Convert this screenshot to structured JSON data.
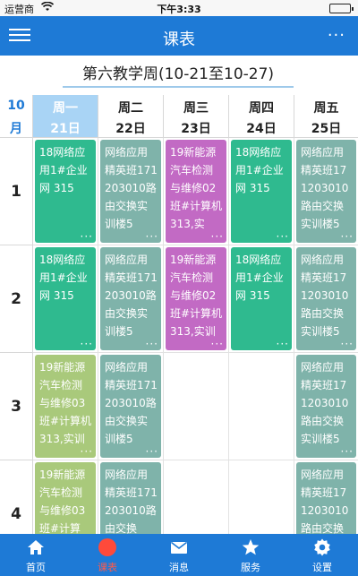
{
  "status_bar": {
    "carrier": "运营商",
    "time": "下午3:33"
  },
  "nav": {
    "title": "课表",
    "more": "···"
  },
  "week": {
    "label": "第六教学周(10-21至10-27)"
  },
  "month": {
    "number": "10",
    "unit": "月"
  },
  "days": [
    {
      "name": "周一",
      "date": "21日",
      "is_today": true
    },
    {
      "name": "周二",
      "date": "22日",
      "is_today": false
    },
    {
      "name": "周三",
      "date": "23日",
      "is_today": false
    },
    {
      "name": "周四",
      "date": "24日",
      "is_today": false
    },
    {
      "name": "周五",
      "date": "25日",
      "is_today": false
    }
  ],
  "periods": [
    "1",
    "2",
    "3",
    "4"
  ],
  "courses": {
    "mon_1": "18网络应用1#企业网 315",
    "tue_1": "网络应用精英班171203010路由交换实训楼5",
    "wed_1": "19新能源汽车检测与维修02班#计算机 313,实",
    "thu_1": "18网络应用1#企业网 315",
    "fri_1": "网络应用精英班171203010路由交换实训楼5",
    "mon_2": "18网络应用1#企业网 315",
    "tue_2": "网络应用精英班171203010路由交换实训楼5",
    "wed_2": "19新能源汽车检测与维修02班#计算机 313,实训",
    "thu_2": "18网络应用1#企业网 315",
    "fri_2": "网络应用精英班171203010路由交换实训楼5",
    "mon_3": "19新能源汽车检测与维修03班#计算机 313,实训",
    "tue_3": "网络应用精英班171203010路由交换实训楼5",
    "fri_3": "网络应用精英班171203010路由交换实训楼5",
    "mon_4": "19新能源汽车检测与维修03班#计算",
    "tue_4": "网络应用精英班171203010路由交换",
    "fri_4": "网络应用精英班171203010路由交换"
  },
  "colors": {
    "primary": "#1e7ad6",
    "teal": "#2fba8f",
    "gray_green": "#7fb3aa",
    "purple": "#c26ac4",
    "olive": "#a9c97b",
    "active_tab": "#ff4a3a"
  },
  "tabs": [
    {
      "label": "首页",
      "icon": "home-icon",
      "active": false
    },
    {
      "label": "课表",
      "icon": "schedule-icon",
      "active": true
    },
    {
      "label": "消息",
      "icon": "mail-icon",
      "active": false
    },
    {
      "label": "服务",
      "icon": "star-icon",
      "active": false
    },
    {
      "label": "设置",
      "icon": "gear-icon",
      "active": false
    }
  ]
}
